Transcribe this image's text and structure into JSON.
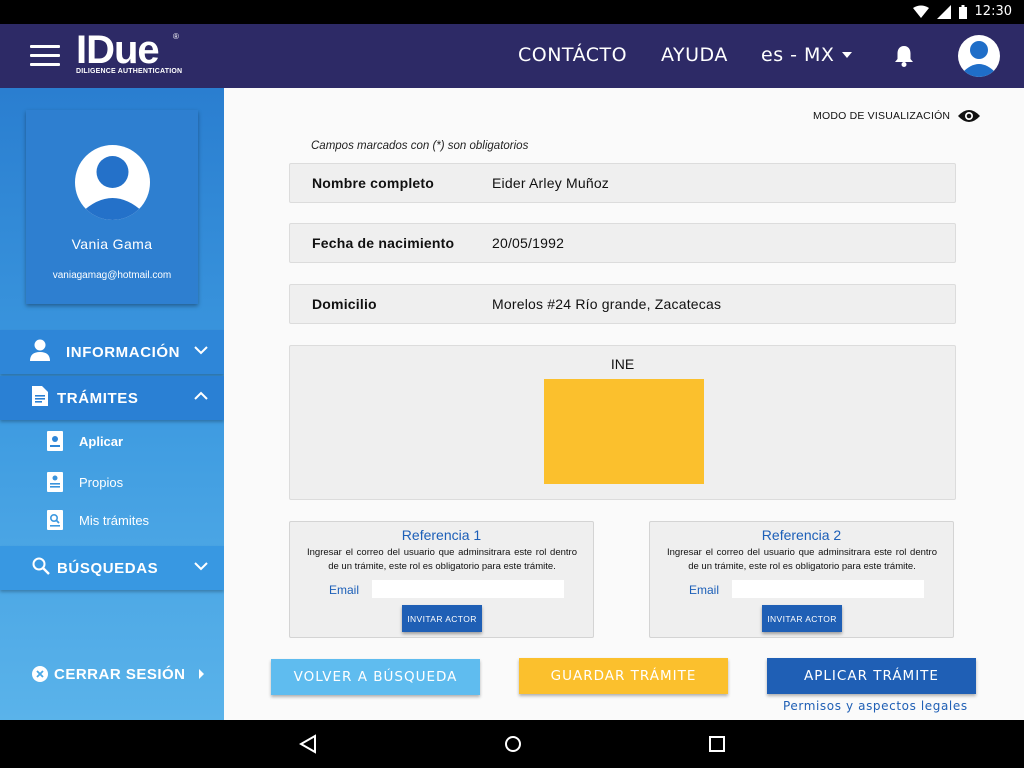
{
  "status_bar": {
    "time": "12:30"
  },
  "header": {
    "logo_main": "IDue",
    "logo_sub": "DILIGENCE AUTHENTICATION",
    "logo_reg": "®",
    "nav_contacto": "CONTÁCTO",
    "nav_ayuda": "AYUDA",
    "language": "es - MX"
  },
  "sidebar": {
    "profile": {
      "name": "Vania Gama",
      "email": "vaniagamag@hotmail.com"
    },
    "sections": {
      "informacion": "INFORMACIÓN",
      "tramites": "TRÁMITES",
      "busquedas": "BÚSQUEDAS"
    },
    "sub_items": {
      "aplicar": "Aplicar",
      "propios": "Propios",
      "mis_tramites": "Mis trámites"
    },
    "logout": "CERRAR SESIÓN"
  },
  "main": {
    "view_mode": "MODO DE VISUALIZACIÓN",
    "required_note": "Campos marcados con (*) son obligatorios",
    "fields": [
      {
        "label": "Nombre completo",
        "value": "Eider Arley Muñoz"
      },
      {
        "label": "Fecha de nacimiento",
        "value": "20/05/1992"
      },
      {
        "label": "Domicilio",
        "value": "Morelos #24 Río grande, Zacatecas"
      }
    ],
    "ine_label": "INE",
    "references": [
      {
        "title": "Referencia 1",
        "description": "Ingresar el correo del usuario que adminsitrara este rol dentro de un trámite, este rol es obligatorio para este trámite.",
        "email_label": "Email",
        "email_value": "",
        "invite_label": "INVITAR ACTOR"
      },
      {
        "title": "Referencia 2",
        "description": "Ingresar el correo del usuario que adminsitrara este rol dentro de un trámite, este rol es obligatorio para este trámite.",
        "email_label": "Email",
        "email_value": "",
        "invite_label": "INVITAR ACTOR"
      }
    ],
    "buttons": {
      "volver": "VOLVER A BÚSQUEDA",
      "guardar": "GUARDAR TRÁMITE",
      "aplicar": "APLICAR TRÁMITE"
    },
    "legal_link": "Permisos y aspectos legales"
  },
  "colors": {
    "header_bg": "#2d2a66",
    "sidebar_blue": "#2e86d8",
    "accent_yellow": "#fbc02d",
    "primary_blue": "#1f5fb5",
    "light_blue": "#5fbcef"
  },
  "icons": {
    "menu": "hamburger-menu-icon",
    "bell": "bell-icon",
    "avatar": "user-avatar-icon",
    "eye": "eye-icon",
    "user": "person-icon",
    "document": "document-icon",
    "search": "search-icon",
    "close": "close-circle-icon"
  }
}
